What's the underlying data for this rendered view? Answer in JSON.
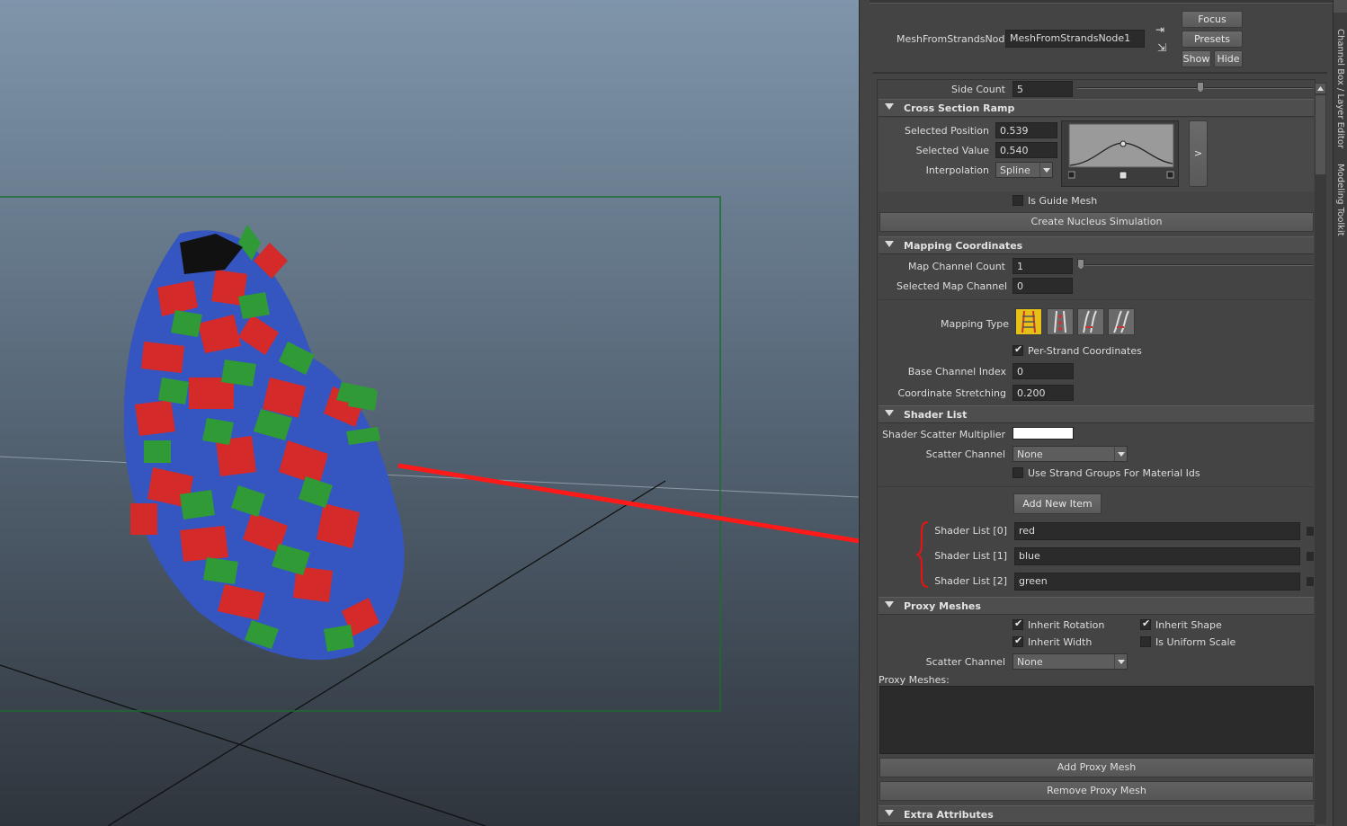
{
  "node": {
    "label": "MeshFromStrandsNode:",
    "value": "MeshFromStrandsNode1",
    "focus_label": "Focus",
    "presets_label": "Presets",
    "show_label": "Show",
    "hide_label": "Hide"
  },
  "side_count": {
    "label": "Side Count",
    "value": "5"
  },
  "cross_section": {
    "title": "Cross Section Ramp",
    "selected_position_label": "Selected Position",
    "selected_position": "0.539",
    "selected_value_label": "Selected Value",
    "selected_value": "0.540",
    "interpolation_label": "Interpolation",
    "interpolation": "Spline",
    "expand_label": ">",
    "is_guide_mesh_label": "Is Guide Mesh",
    "is_guide_mesh": false,
    "create_nucleus_label": "Create Nucleus Simulation"
  },
  "mapping": {
    "title": "Mapping Coordinates",
    "map_channel_count_label": "Map Channel Count",
    "map_channel_count": "1",
    "selected_map_channel_label": "Selected Map Channel",
    "selected_map_channel": "0",
    "mapping_type_label": "Mapping Type",
    "mapping_type_icons": [
      "mapping-type-1-icon",
      "mapping-type-2-icon",
      "mapping-type-3-icon",
      "mapping-type-4-icon"
    ],
    "per_strand_label": "Per-Strand Coordinates",
    "per_strand": true,
    "base_channel_index_label": "Base Channel Index",
    "base_channel_index": "0",
    "coordinate_stretching_label": "Coordinate Stretching",
    "coordinate_stretching": "0.200"
  },
  "shader_list": {
    "title": "Shader List",
    "scatter_multiplier_label": "Shader Scatter Multiplier",
    "scatter_channel_label": "Scatter Channel",
    "scatter_channel": "None",
    "use_strand_groups_label": "Use Strand Groups For Material Ids",
    "add_new_item_label": "Add New Item",
    "items": [
      {
        "label": "Shader List [0]",
        "value": "red"
      },
      {
        "label": "Shader List [1]",
        "value": "blue"
      },
      {
        "label": "Shader List [2]",
        "value": "green"
      }
    ]
  },
  "proxy": {
    "title": "Proxy Meshes",
    "inherit_rotation_label": "Inherit Rotation",
    "inherit_shape_label": "Inherit Shape",
    "inherit_width_label": "Inherit Width",
    "is_uniform_scale_label": "Is Uniform Scale",
    "scatter_channel_label": "Scatter Channel",
    "scatter_channel": "None",
    "proxy_meshes_label": "Proxy Meshes:",
    "add_label": "Add Proxy Mesh",
    "remove_label": "Remove Proxy Mesh"
  },
  "extra": {
    "title": "Extra Attributes"
  },
  "side_tabs": [
    "Channel Box / Layer Editor",
    "Modeling Toolkit"
  ],
  "colors": {
    "accent_arrow": "#ff1a1a",
    "mesh_red": "#d42a2a",
    "mesh_blue": "#3556c0",
    "mesh_green": "#2f9a36"
  }
}
